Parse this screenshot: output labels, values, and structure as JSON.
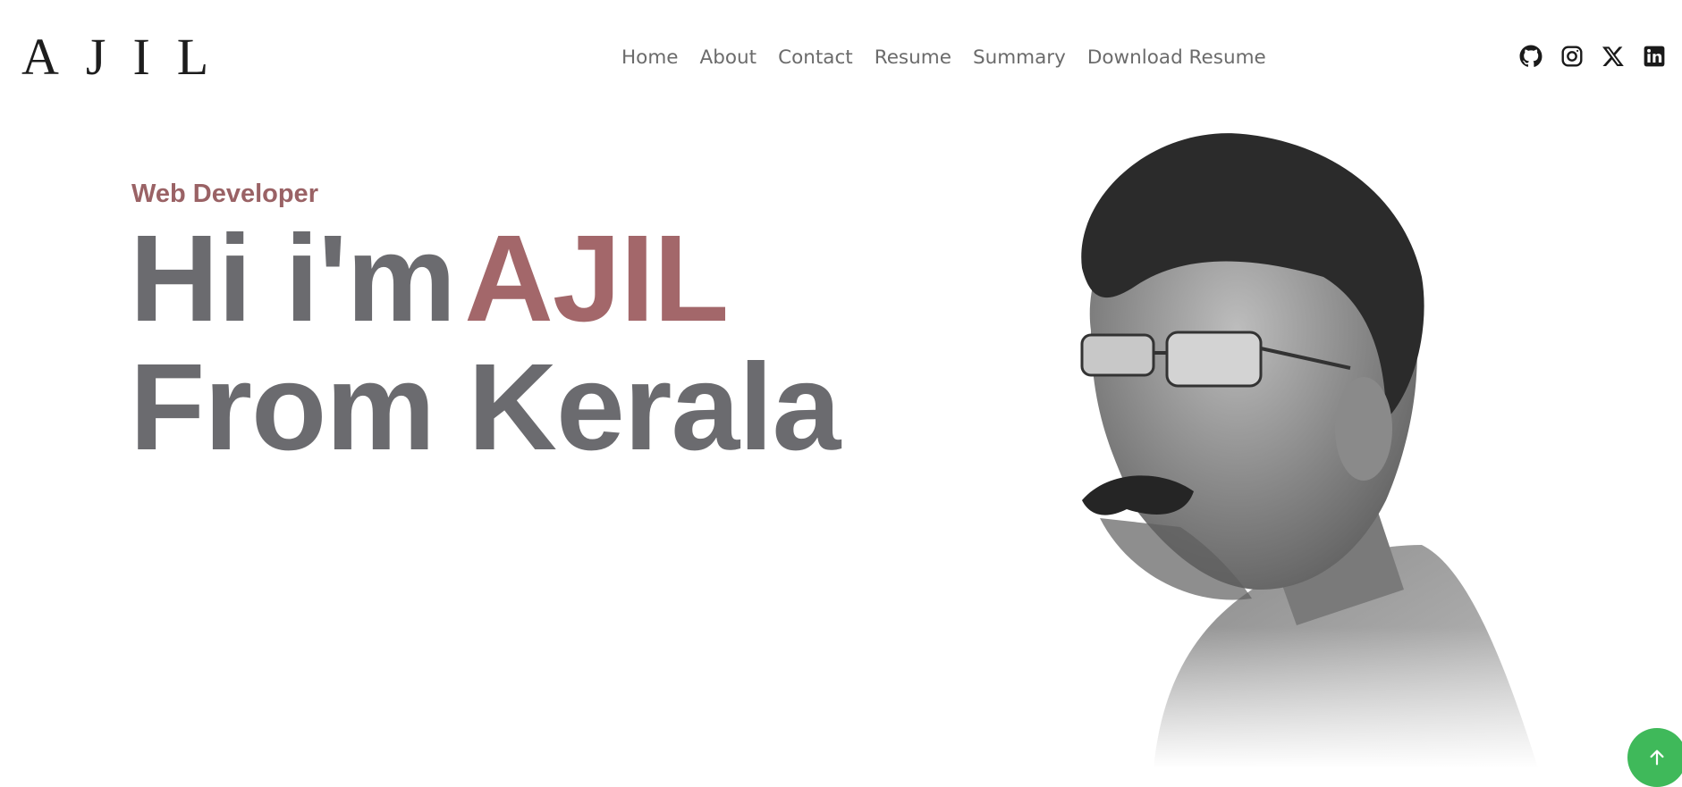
{
  "logo": "AJIL",
  "nav": {
    "items": [
      "Home",
      "About",
      "Contact",
      "Resume",
      "Summary",
      "Download Resume"
    ]
  },
  "social": {
    "icons": [
      "github-icon",
      "instagram-icon",
      "x-icon",
      "linkedin-icon"
    ]
  },
  "hero": {
    "role": "Web Developer",
    "greeting": "Hi i'm",
    "name": "AJIL",
    "line2": "From Kerala"
  },
  "colors": {
    "accent": "#a3676a",
    "headline": "#6b6b6f",
    "nav_text": "#6b6b6b",
    "scroll_button": "#3fb95a"
  }
}
